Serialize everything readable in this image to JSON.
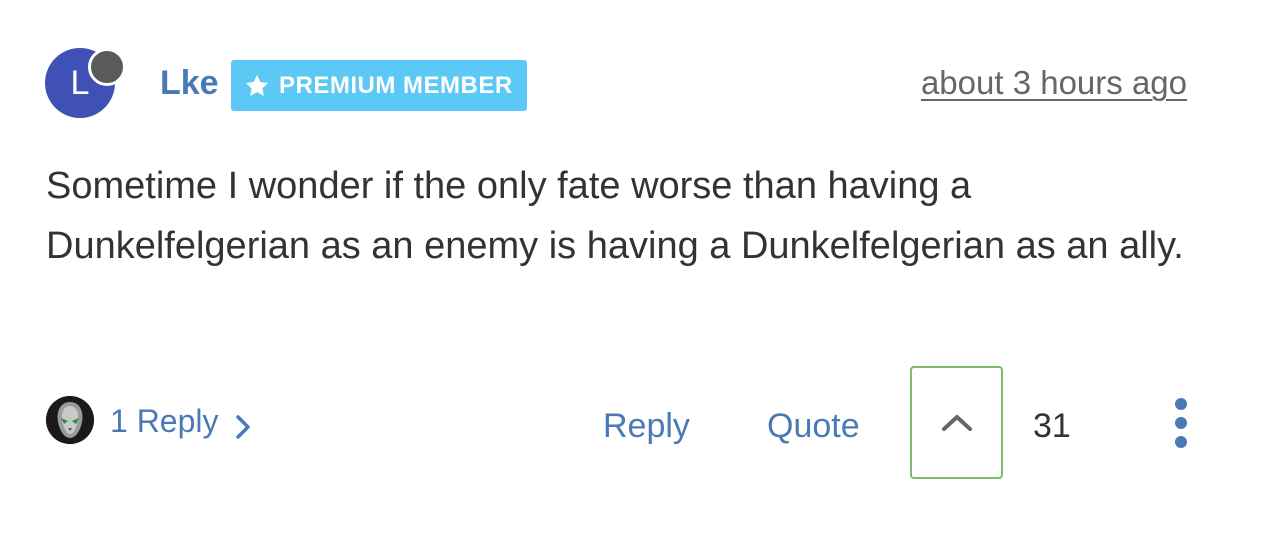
{
  "comment": {
    "author": {
      "initial": "L",
      "name": "Lke",
      "badge_label": "PREMIUM MEMBER"
    },
    "timestamp": "about 3 hours ago",
    "body": "Sometime I wonder if the only fate worse than having a Dunkelfelgerian as an enemy is having a Dunkelfelgerian as an ally.",
    "footer": {
      "replies_label": "1 Reply",
      "reply_label": "Reply",
      "quote_label": "Quote",
      "vote_count": "31"
    }
  },
  "colors": {
    "link_blue": "#4a7ab5",
    "avatar_bg": "#3f51b5",
    "badge_bg": "#5bc8f5",
    "upvote_border": "#7dbb6d"
  },
  "icons": {
    "badge": "star-icon",
    "replies": "chevron-right-icon",
    "upvote": "chevron-up-icon",
    "more": "more-vertical-icon"
  }
}
